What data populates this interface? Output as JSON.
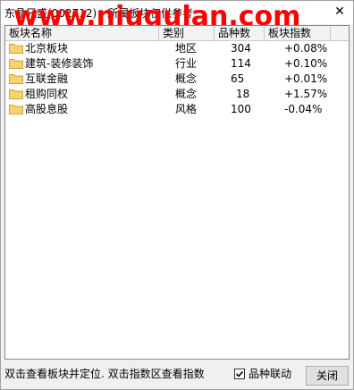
{
  "window": {
    "title": "东晶兄盛(002712) - 所属板块仅供参考",
    "watermark": "www.niugulan.com"
  },
  "table": {
    "columns": [
      "板块名称",
      "类别",
      "品种数",
      "板块指数"
    ],
    "rows": [
      {
        "name": "北京板块",
        "category": "地区",
        "count": "304",
        "index": "+0.08%"
      },
      {
        "name": "建筑-装修装饰",
        "category": "行业",
        "count": "114",
        "index": "+0.10%"
      },
      {
        "name": "互联金融",
        "category": "概念",
        "count": "65",
        "index": "+0.01%"
      },
      {
        "name": "租购同权",
        "category": "概念",
        "count": "18",
        "index": "+1.57%"
      },
      {
        "name": "高股息股",
        "category": "风格",
        "count": "100",
        "index": "-0.04%"
      }
    ]
  },
  "footer": {
    "hint": "双击查看板块并定位. 双击指数区查看指数",
    "checkbox_label": "品种联动",
    "checkbox_checked": true,
    "close_label": "关闭"
  },
  "colors": {
    "folder": "#f7d46b",
    "folder_border": "#c9a23a"
  },
  "icons": [
    "folder-icon",
    "close-icon",
    "checkmark-icon"
  ]
}
